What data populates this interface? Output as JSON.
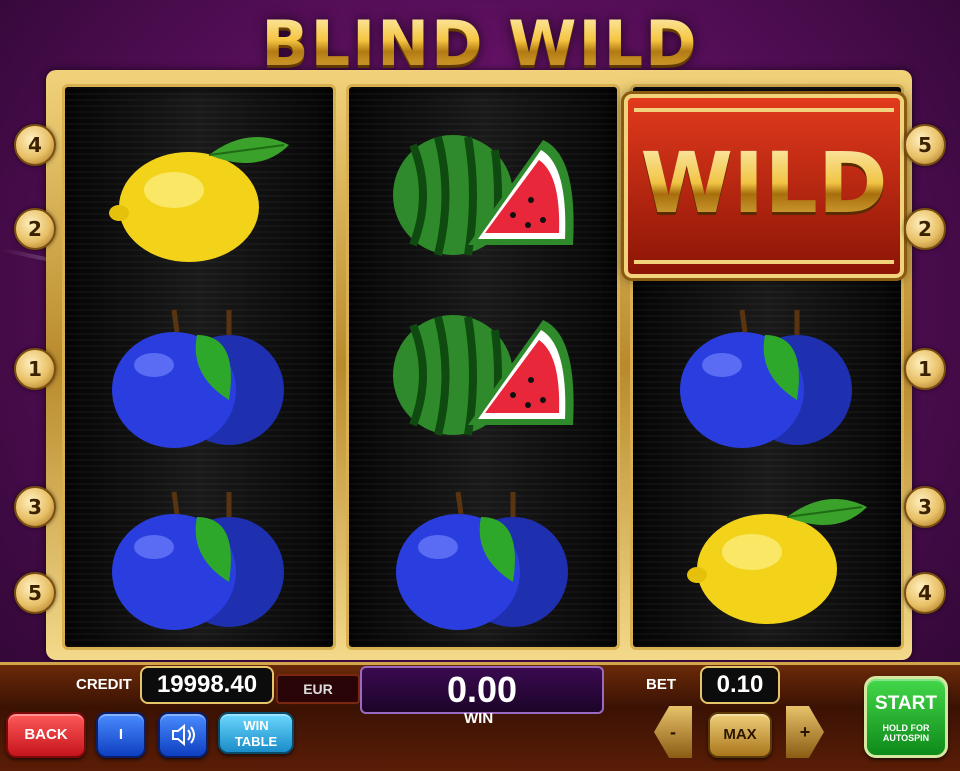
{
  "game": {
    "title": "BLIND WILD",
    "wild_label": "WILD"
  },
  "reels": [
    {
      "symbols": [
        "lemon",
        "plum",
        "plum"
      ]
    },
    {
      "symbols": [
        "watermelon",
        "watermelon",
        "plum"
      ]
    },
    {
      "symbols": [
        "wild",
        "plum",
        "lemon"
      ]
    }
  ],
  "paylines": {
    "left": [
      "4",
      "2",
      "1",
      "3",
      "5"
    ],
    "right": [
      "5",
      "2",
      "1",
      "3",
      "4"
    ]
  },
  "panel": {
    "credit_label": "CREDIT",
    "credit_value": "19998.40",
    "currency": "EUR",
    "win_value": "0.00",
    "win_label": "WIN",
    "bet_label": "BET",
    "bet_value": "0.10"
  },
  "buttons": {
    "back": "BACK",
    "info": "I",
    "wintable_line1": "WIN",
    "wintable_line2": "TABLE",
    "minus": "-",
    "max": "MAX",
    "plus": "+",
    "start": "START",
    "start_sub1": "HOLD FOR",
    "start_sub2": "AUTOSPIN"
  },
  "icons": {
    "sound": "speaker-icon"
  }
}
